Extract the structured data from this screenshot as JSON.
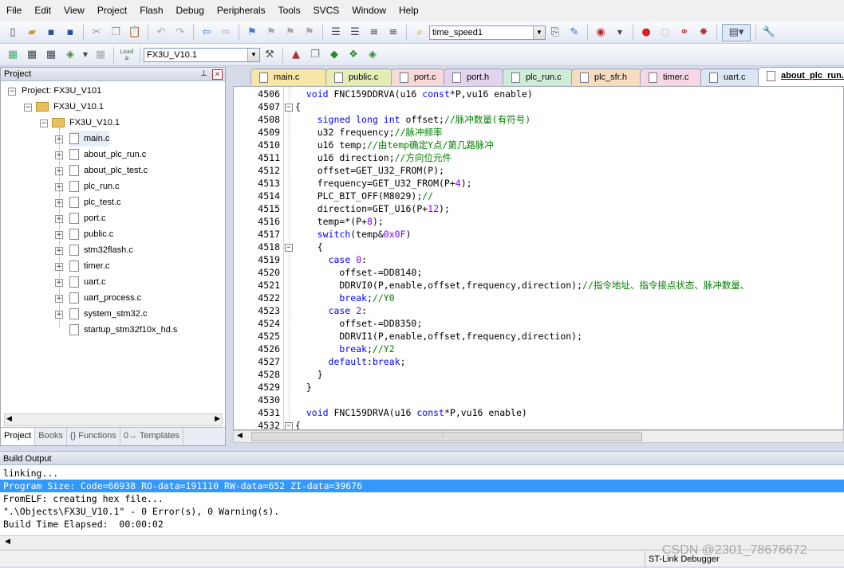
{
  "menu": [
    "File",
    "Edit",
    "View",
    "Project",
    "Flash",
    "Debug",
    "Peripherals",
    "Tools",
    "SVCS",
    "Window",
    "Help"
  ],
  "toolbar1": {
    "find_combo_value": "time_speed1"
  },
  "toolbar2": {
    "target_combo_value": "FX3U_V10.1",
    "load_label": "Load"
  },
  "project_panel": {
    "title": "Project",
    "root": "Project: FX3U_V101",
    "target": "FX3U_V10.1",
    "group": "FX3U_V10.1",
    "files": [
      "main.c",
      "about_plc_run.c",
      "about_plc_test.c",
      "plc_run.c",
      "plc_test.c",
      "port.c",
      "public.c",
      "stm32flash.c",
      "timer.c",
      "uart.c",
      "uart_process.c",
      "system_stm32.c",
      "startup_stm32f10x_hd.s"
    ],
    "tabs": [
      "Project",
      "Books",
      "{} Functions",
      "0→ Templates"
    ]
  },
  "editor_tabs": [
    {
      "label": "main.c",
      "color": "#f6e6a8"
    },
    {
      "label": "public.c",
      "color": "#e6edb4"
    },
    {
      "label": "port.c",
      "color": "#f7d9d9"
    },
    {
      "label": "port.h",
      "color": "#e2d3ee"
    },
    {
      "label": "plc_run.c",
      "color": "#cfecd6"
    },
    {
      "label": "plc_sfr.h",
      "color": "#f7dcc0"
    },
    {
      "label": "timer.c",
      "color": "#f5d8e3"
    },
    {
      "label": "uart.c",
      "color": "#dde6f3"
    },
    {
      "label": "about_plc_run.c",
      "color": "#ffffff"
    }
  ],
  "code": [
    {
      "ln": "4506",
      "fold": "",
      "html": "  <span class='kw'>void</span> FNC159DDRVA(u16 <span class='kw'>const</span>*P,vu16 enable)"
    },
    {
      "ln": "4507",
      "fold": "-",
      "html": "{"
    },
    {
      "ln": "4508",
      "fold": "",
      "html": "    <span class='kw'>signed long int</span> offset;<span class='cm'>//脉冲数量(有符号)</span>"
    },
    {
      "ln": "4509",
      "fold": "",
      "html": "    u32 frequency;<span class='cm'>//脉冲频率</span>"
    },
    {
      "ln": "4510",
      "fold": "",
      "html": "    u16 temp;<span class='cm'>//由temp确定Y点/第几路脉冲</span>"
    },
    {
      "ln": "4511",
      "fold": "",
      "html": "    u16 direction;<span class='cm'>//方向位元件</span>"
    },
    {
      "ln": "4512",
      "fold": "",
      "html": "    offset=GET_U32_FROM(P);"
    },
    {
      "ln": "4513",
      "fold": "",
      "html": "    frequency=GET_U32_FROM(P+<span class='num'>4</span>);"
    },
    {
      "ln": "4514",
      "fold": "",
      "html": "    PLC_BIT_OFF(M8029);<span class='cm'>//</span>"
    },
    {
      "ln": "4515",
      "fold": "",
      "html": "    direction=GET_U16(P+<span class='num'>12</span>);"
    },
    {
      "ln": "4516",
      "fold": "",
      "html": "    temp=*(P+<span class='num'>8</span>);"
    },
    {
      "ln": "4517",
      "fold": "",
      "html": "    <span class='kw'>switch</span>(temp&amp;<span class='num'>0x0F</span>)"
    },
    {
      "ln": "4518",
      "fold": "-",
      "html": "    {"
    },
    {
      "ln": "4519",
      "fold": "",
      "html": "      <span class='kw'>case</span> <span class='num'>0</span>:"
    },
    {
      "ln": "4520",
      "fold": "",
      "html": "        offset-=DD8140;"
    },
    {
      "ln": "4521",
      "fold": "",
      "html": "        DDRVI0(P,enable,offset,frequency,direction);<span class='cm'>//指令地址、指令接点状态、脉冲数量、</span>"
    },
    {
      "ln": "4522",
      "fold": "",
      "html": "        <span class='kw'>break</span>;<span class='cm'>//Y0</span>"
    },
    {
      "ln": "4523",
      "fold": "",
      "html": "      <span class='kw'>case</span> <span class='num'>2</span>:"
    },
    {
      "ln": "4524",
      "fold": "",
      "html": "        offset-=DD8350;"
    },
    {
      "ln": "4525",
      "fold": "",
      "html": "        DDRVI1(P,enable,offset,frequency,direction);"
    },
    {
      "ln": "4526",
      "fold": "",
      "html": "        <span class='kw'>break</span>;<span class='cm'>//Y2</span>"
    },
    {
      "ln": "4527",
      "fold": "",
      "html": "      <span class='kw'>default</span>:<span class='kw'>break</span>;"
    },
    {
      "ln": "4528",
      "fold": "",
      "html": "    }"
    },
    {
      "ln": "4529",
      "fold": "",
      "html": "  }"
    },
    {
      "ln": "4530",
      "fold": "",
      "html": ""
    },
    {
      "ln": "4531",
      "fold": "",
      "html": "  <span class='kw'>void</span> FNC159DRVA(u16 <span class='kw'>const</span>*P,vu16 enable)"
    },
    {
      "ln": "4532",
      "fold": "-",
      "html": "{"
    }
  ],
  "build_output": {
    "title": "Build Output",
    "lines": [
      "linking...",
      "Program Size: Code=66938 RO-data=191110 RW-data=652 ZI-data=39676",
      "FromELF: creating hex file...",
      "\".\\Objects\\FX3U_V10.1\" - 0 Error(s), 0 Warning(s).",
      "Build Time Elapsed:  00:00:02"
    ],
    "selected_index": 1
  },
  "status": {
    "debugger": "ST-Link Debugger",
    "watermark": "CSDN @2301_78676672"
  }
}
